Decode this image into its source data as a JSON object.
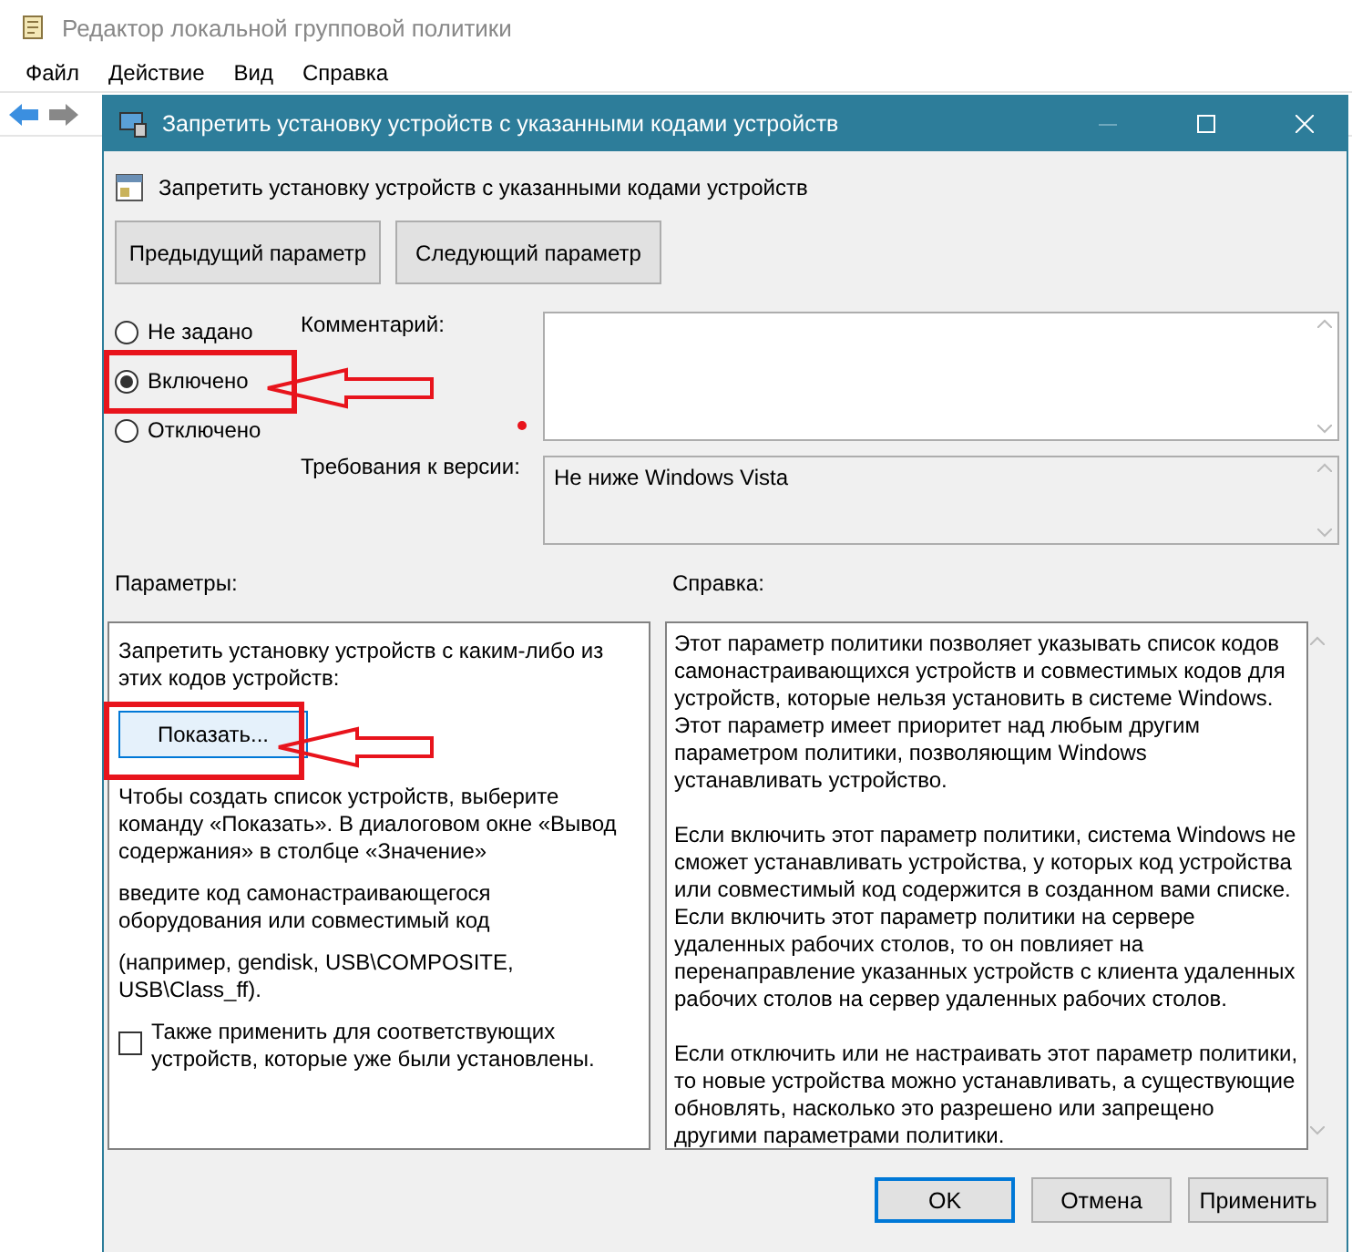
{
  "main_window": {
    "title": "Редактор локальной групповой политики",
    "menu": [
      "Файл",
      "Действие",
      "Вид",
      "Справка"
    ]
  },
  "dialog": {
    "title": "Запретить установку устройств с указанными кодами устройств",
    "policy_title": "Запретить установку устройств с указанными кодами устройств",
    "nav_buttons": [
      "Предыдущий параметр",
      "Следующий параметр"
    ],
    "states": [
      {
        "label": "Не задано",
        "selected": false
      },
      {
        "label": "Включено",
        "selected": true
      },
      {
        "label": "Отключено",
        "selected": false
      }
    ],
    "comment_label": "Комментарий:",
    "requirements_label": "Требования к версии:",
    "requirements": "Не ниже Windows Vista",
    "options_label": "Параметры:",
    "help_label": "Справка:",
    "options": [
      {
        "kind": "text",
        "text": "Запретить установку устройств с каким-либо из этих кодов устройств:"
      },
      {
        "kind": "button",
        "label": "Показать..."
      },
      {
        "kind": "text",
        "text": "Чтобы создать список устройств, выберите команду «Показать». В диалоговом окне «Вывод содержания» в столбце «Значение»"
      },
      {
        "kind": "text",
        "text": "введите код самонастраивающегося оборудования или совместимый код"
      },
      {
        "kind": "text",
        "text": "(например, gendisk, USB\\COMPOSITE, USB\\Class_ff)."
      },
      {
        "kind": "checkbox",
        "label": "Также применить для соответствующих устройств, которые уже были установлены.",
        "checked": false
      }
    ],
    "help": [
      "Этот параметр политики позволяет указывать список кодов самонастраивающихся устройств и совместимых кодов для устройств, которые нельзя установить в системе Windows.\nЭтот параметр имеет приоритет над любым другим параметром политики, позволяющим Windows устанавливать устройство.",
      "Если включить этот параметр политики, система Windows не сможет устанавливать устройства, у которых код устройства или совместимый код содержится в созданном вами списке.\nЕсли включить этот параметр политики на сервере удаленных рабочих столов, то он повлияет на перенаправление указанных устройств с клиента удаленных рабочих столов на сервер удаленных рабочих столов.",
      "Если отключить или не настраивать этот параметр политики, то новые устройства можно устанавливать, а существующие обновлять, насколько это разрешено или запрещено другими параметрами политики."
    ],
    "buttons": [
      {
        "label": "OK",
        "default": true
      },
      {
        "label": "Отмена",
        "default": false
      },
      {
        "label": "Применить",
        "default": false
      }
    ]
  }
}
